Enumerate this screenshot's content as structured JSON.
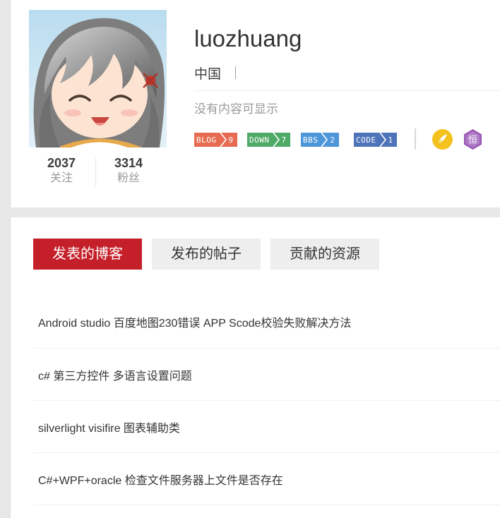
{
  "profile": {
    "username": "luozhuang",
    "location": "中国",
    "bio": "没有内容可显示",
    "stats": {
      "follow_count": "2037",
      "follow_label": "关注",
      "fans_count": "3314",
      "fans_label": "粉丝"
    },
    "badges": [
      {
        "name": "BLOG",
        "count": "9",
        "color": "#e66b50",
        "icon": "blog-badge-icon"
      },
      {
        "name": "DOWN",
        "count": "7",
        "color": "#4faa68",
        "icon": "download-badge-icon"
      },
      {
        "name": "BBS",
        "count": "2",
        "color": "#4d96d9",
        "icon": "forum-badge-icon"
      },
      {
        "name": "CODE",
        "count": "1",
        "color": "#4d73b8",
        "icon": "code-badge-icon"
      }
    ],
    "medals": [
      {
        "icon": "feather-pen-icon",
        "color": "#f4c11e"
      },
      {
        "icon": "persistence-heng-icon",
        "color": "#9b59b6",
        "glyph": "恒"
      }
    ]
  },
  "tabs": [
    {
      "label": "发表的博客",
      "active": true
    },
    {
      "label": "发布的帖子",
      "active": false
    },
    {
      "label": "贡献的资源",
      "active": false
    }
  ],
  "posts": [
    {
      "title": "Android studio 百度地图230错误 APP Scode校验失败解决方法"
    },
    {
      "title": "c# 第三方控件 多语言设置问题"
    },
    {
      "title": "silverlight visifire 图表辅助类"
    },
    {
      "title": "C#+WPF+oracle 检查文件服务器上文件是否存在"
    }
  ],
  "colors": {
    "accent": "#c5202a",
    "page_background": "#e8e8e8"
  }
}
